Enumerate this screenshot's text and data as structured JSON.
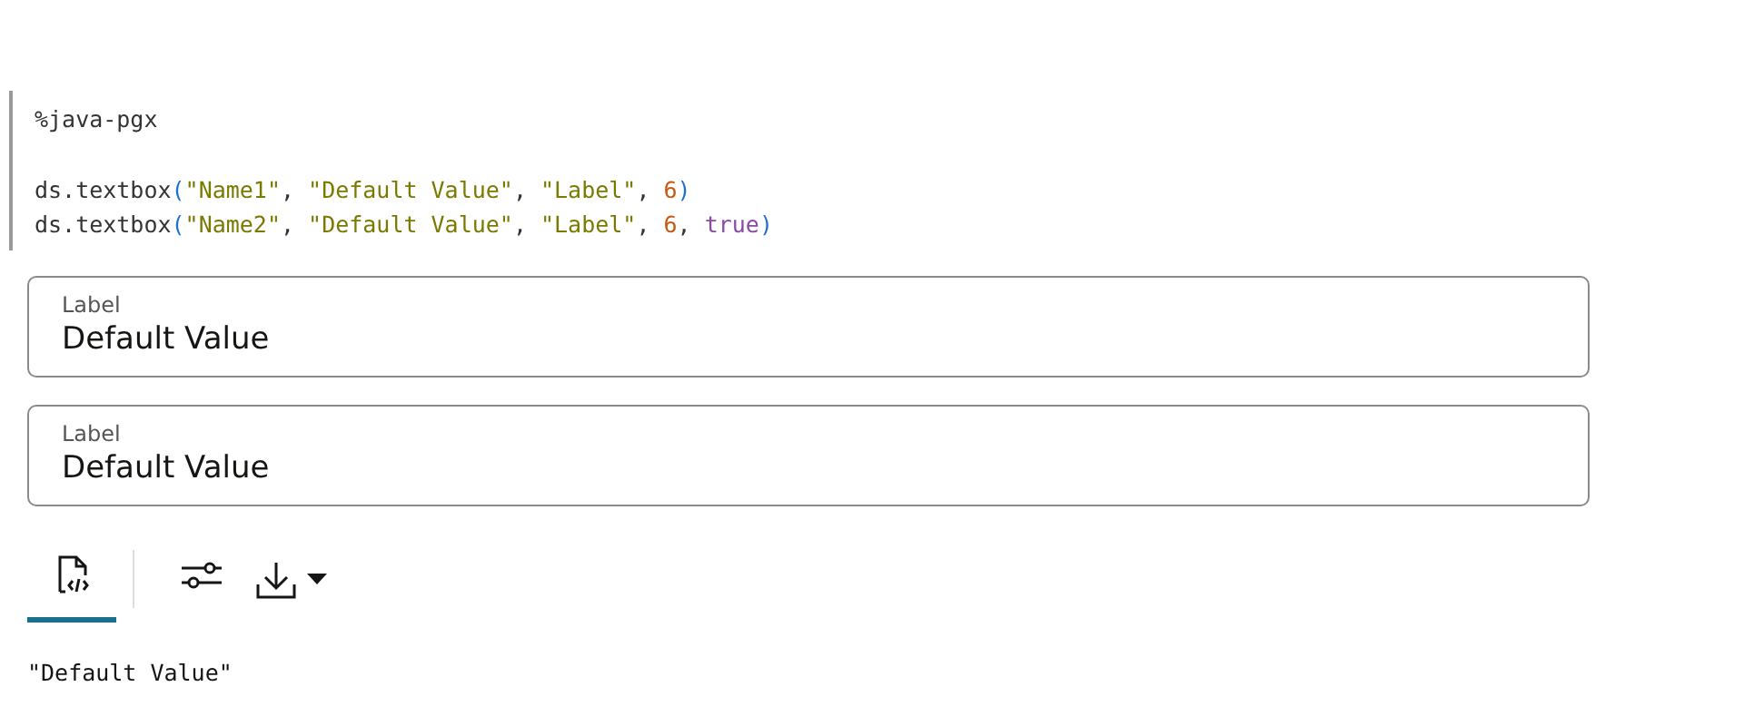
{
  "code_directive": "%java-pgx",
  "code_lines": [
    {
      "tokens": [
        {
          "kind": "plain",
          "text": "ds.textbox"
        },
        {
          "kind": "bracket",
          "text": "("
        },
        {
          "kind": "string",
          "text": "\"Name1\""
        },
        {
          "kind": "plain",
          "text": ", "
        },
        {
          "kind": "string",
          "text": "\"Default Value\""
        },
        {
          "kind": "plain",
          "text": ", "
        },
        {
          "kind": "string",
          "text": "\"Label\""
        },
        {
          "kind": "plain",
          "text": ", "
        },
        {
          "kind": "number",
          "text": "6"
        },
        {
          "kind": "bracket",
          "text": ")"
        }
      ]
    },
    {
      "tokens": [
        {
          "kind": "plain",
          "text": "ds.textbox"
        },
        {
          "kind": "bracket",
          "text": "("
        },
        {
          "kind": "string",
          "text": "\"Name2\""
        },
        {
          "kind": "plain",
          "text": ", "
        },
        {
          "kind": "string",
          "text": "\"Default Value\""
        },
        {
          "kind": "plain",
          "text": ", "
        },
        {
          "kind": "string",
          "text": "\"Label\""
        },
        {
          "kind": "plain",
          "text": ", "
        },
        {
          "kind": "number",
          "text": "6"
        },
        {
          "kind": "plain",
          "text": ", "
        },
        {
          "kind": "keyword",
          "text": "true"
        },
        {
          "kind": "bracket",
          "text": ")"
        }
      ]
    }
  ],
  "fields": [
    {
      "label": "Label",
      "value": "Default Value"
    },
    {
      "label": "Label",
      "value": "Default Value"
    }
  ],
  "view_tabs": [
    {
      "kind": "code",
      "selected": true
    },
    {
      "kind": "settings",
      "selected": false
    }
  ],
  "output": "\"Default Value\""
}
